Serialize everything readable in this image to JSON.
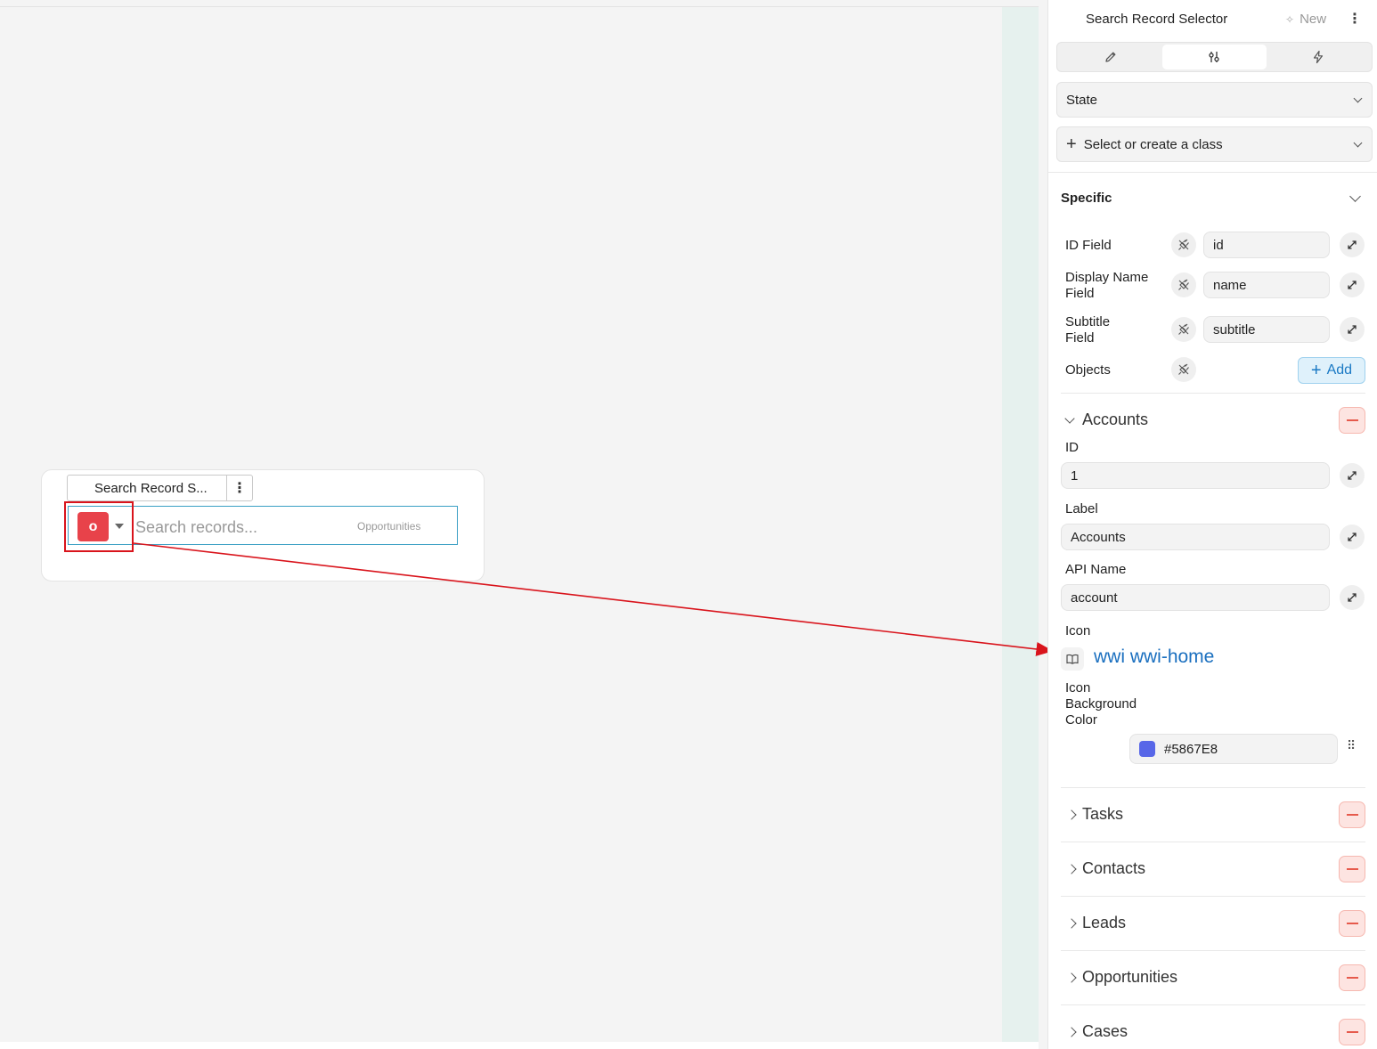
{
  "canvas": {
    "widget": {
      "tab_label": "Search Record S...",
      "menu_icon": "vertical-dots-icon",
      "badge_letter": "o",
      "badge_color": "#e8424a",
      "search_placeholder": "Search records...",
      "object_label": "Opportunities"
    }
  },
  "panel": {
    "title": "Search Record Selector",
    "new_label": "New",
    "tabs": [
      {
        "icon": "pencil-icon",
        "active": false
      },
      {
        "icon": "sliders-icon",
        "active": true
      },
      {
        "icon": "lightning-icon",
        "active": false
      }
    ],
    "state_select": "State",
    "class_select": "Select or create a class",
    "section_title": "Specific",
    "props": {
      "id_field": {
        "label": "ID Field",
        "value": "id"
      },
      "display_name_field": {
        "label": "Display Name Field",
        "value": "name"
      },
      "subtitle_field": {
        "label": "Subtitle Field",
        "value": "subtitle"
      },
      "objects": {
        "label": "Objects",
        "add_label": "Add"
      }
    },
    "objects": {
      "accounts": {
        "name": "Accounts",
        "id_label": "ID",
        "id_value": "1",
        "label_label": "Label",
        "label_value": "Accounts",
        "api_label": "API Name",
        "api_value": "account",
        "icon_label": "Icon",
        "icon_value": "wwi wwi-home",
        "bg_label": "Icon Background Color",
        "bg_value": "#5867E8",
        "bg_color": "#5867E8"
      },
      "collapsed": [
        "Tasks",
        "Contacts",
        "Leads",
        "Opportunities",
        "Cases"
      ]
    }
  }
}
